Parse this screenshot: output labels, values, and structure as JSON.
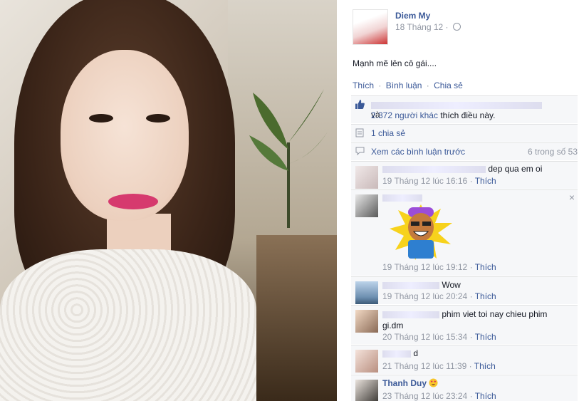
{
  "post": {
    "author": "Diem My",
    "date": "18 Tháng 12",
    "dot": "·",
    "status": "Mạnh mẽ lên cô gái....",
    "actions": {
      "like": "Thích",
      "comment": "Bình luận",
      "share": "Chia sẻ",
      "sep": "·"
    },
    "likes": {
      "conj": "và",
      "others": "2.372 người khác",
      "suffix": "thích điều này."
    },
    "shares": "1 chia sẻ",
    "previous": {
      "label": "Xem các bình luận trước",
      "count": "6 trong số 53"
    }
  },
  "comments": [
    {
      "text": "dep qua em oi",
      "time": "19 Tháng 12 lúc 16:16",
      "like": "Thích"
    },
    {
      "text": "",
      "time": "19 Tháng 12 lúc 19:12",
      "like": "Thích",
      "close": "×"
    },
    {
      "text": "Wow",
      "time": "19 Tháng 12 lúc 20:24",
      "like": "Thích"
    },
    {
      "text": "phim viet toi nay chieu phim",
      "text2": "gi.dm",
      "time": "20 Tháng 12 lúc 15:34",
      "like": "Thích"
    },
    {
      "name_tail": "d",
      "time": "21 Tháng 12 lúc 11:39",
      "like": "Thích"
    },
    {
      "name": "Thanh Duy",
      "time": "23 Tháng 12 lúc 23:24",
      "like": "Thích"
    }
  ],
  "colors": {
    "link": "#3b5998",
    "muted": "#9197a3",
    "bg": "#f6f7f9"
  }
}
